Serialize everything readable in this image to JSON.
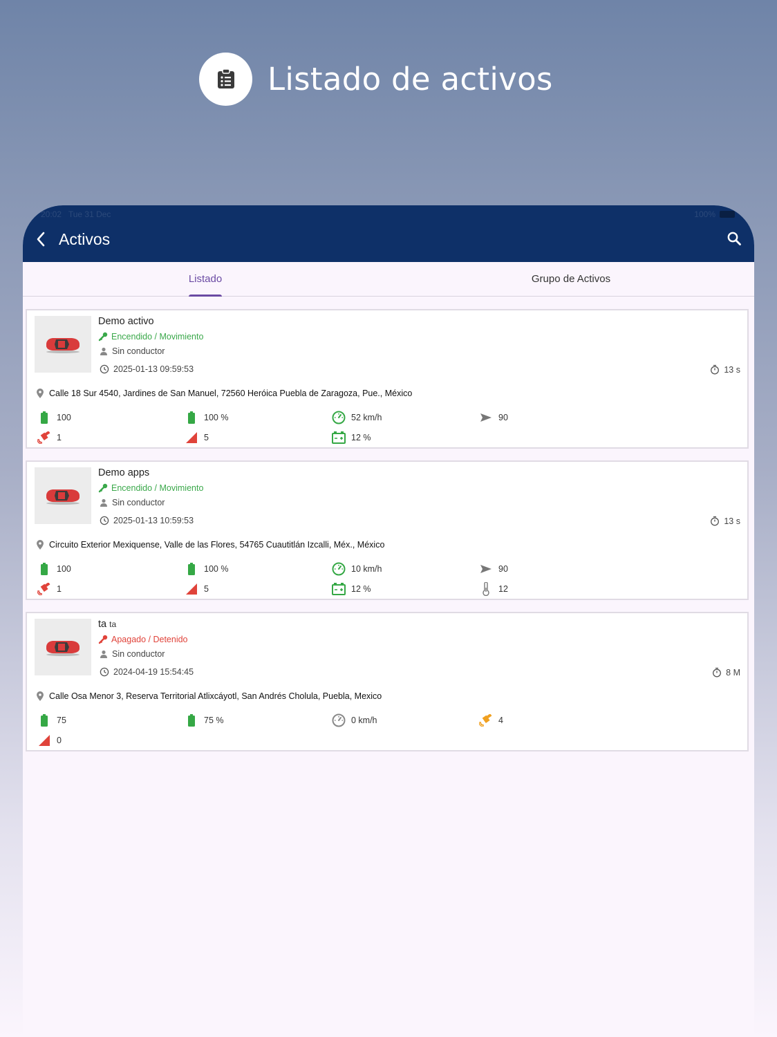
{
  "promo": {
    "title": "Listado de activos",
    "icon": "clipboard-list-icon"
  },
  "statusbar": {
    "time": "20:02",
    "date": "Tue 31 Dec",
    "battery": "100%"
  },
  "appbar": {
    "title": "Activos"
  },
  "tabs": [
    {
      "label": "Listado",
      "active": true
    },
    {
      "label": "Grupo de Activos",
      "active": false
    }
  ],
  "colors": {
    "appbar": "#0e3068",
    "tab_active": "#6a4aa3",
    "on": "#3aa84a",
    "off": "#e0433a"
  },
  "assets": [
    {
      "name": "Demo activo",
      "name_sub": "",
      "state": "Encendido / Movimiento",
      "state_kind": "on",
      "driver": "Sin conductor",
      "datetime": "2025-01-13 09:59:53",
      "elapsed": "13 s",
      "address": "Calle 18 Sur 4540, Jardines de San Manuel, 72560 Heróica Puebla de Zaragoza, Pue., México",
      "metrics": {
        "battery_value": "100",
        "battery_pct": "100 %",
        "speed": "52 km/h",
        "heading": "90",
        "satellites": "1",
        "signal": "5",
        "ext_battery": "12 %"
      }
    },
    {
      "name": "Demo apps",
      "name_sub": "",
      "state": "Encendido / Movimiento",
      "state_kind": "on",
      "driver": "Sin conductor",
      "datetime": "2025-01-13 10:59:53",
      "elapsed": "13 s",
      "address": "Circuito Exterior Mexiquense, Valle de las Flores, 54765 Cuautitlán Izcalli, Méx., México",
      "metrics": {
        "battery_value": "100",
        "battery_pct": "100 %",
        "speed": "10 km/h",
        "heading": "90",
        "satellites": "1",
        "signal": "5",
        "ext_battery": "12 %",
        "temperature": "12"
      }
    },
    {
      "name": "ta",
      "name_sub": "ta",
      "state": "Apagado / Detenido",
      "state_kind": "off",
      "driver": "Sin conductor",
      "datetime": "2024-04-19 15:54:45",
      "elapsed": "8 M",
      "address": "Calle Osa Menor 3, Reserva Territorial Atlixcáyotl, San Andrés Cholula, Puebla, Mexico",
      "metrics": {
        "battery_value": "75",
        "battery_pct": "75 %",
        "speed": "0 km/h",
        "satellites": "4",
        "signal": "0"
      }
    }
  ]
}
